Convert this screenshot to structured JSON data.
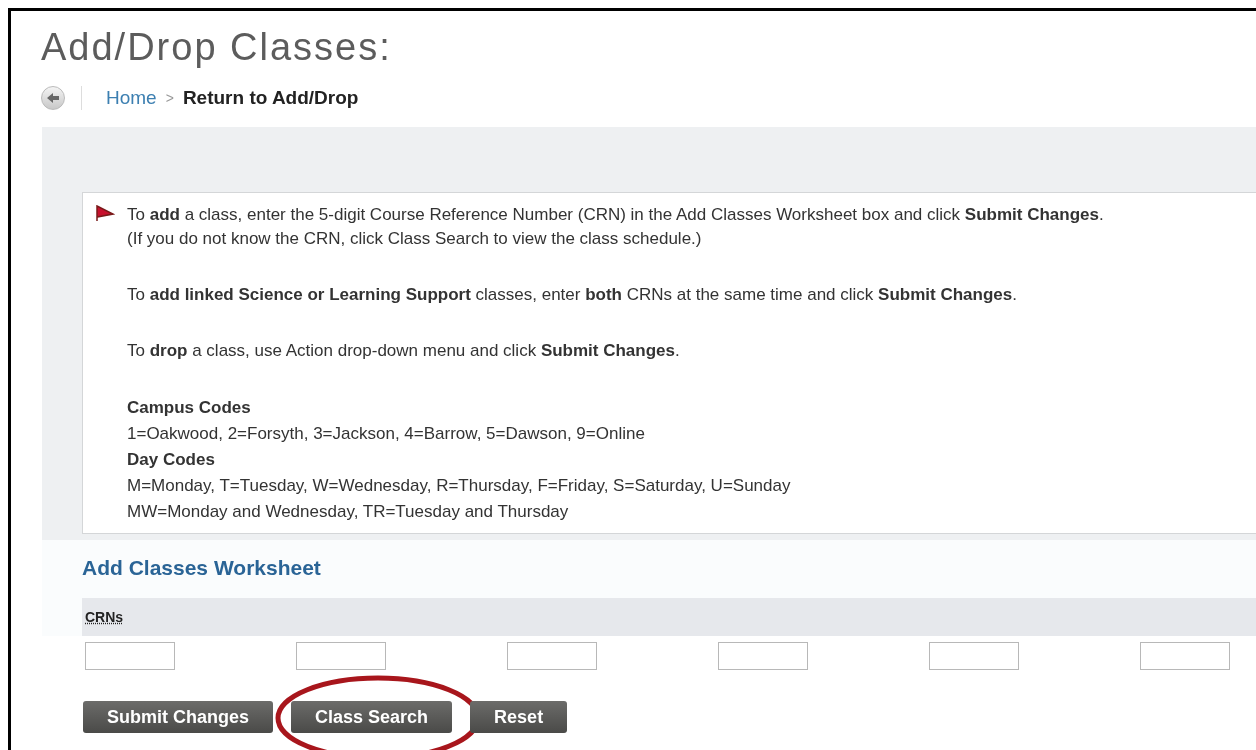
{
  "title": "Add/Drop Classes:",
  "breadcrumb": {
    "home": "Home",
    "separator": ">",
    "current": "Return to Add/Drop"
  },
  "instructions": [
    {
      "kind": "paragraph",
      "flag": true,
      "lines": [
        "To **add** a class, enter the 5-digit Course Reference Number (CRN) in the Add Classes Worksheet box and click **Submit Changes**.",
        "(If you do not know the CRN, click Class Search to view the class schedule.)"
      ]
    },
    {
      "kind": "paragraph",
      "flag": false,
      "lines": [
        "To **add linked Science or Learning Support** classes, enter **both** CRNs at the same time and click **Submit Changes**."
      ]
    },
    {
      "kind": "paragraph",
      "flag": false,
      "lines": [
        "To **drop** a class, use Action drop-down menu and click **Submit Changes**."
      ]
    },
    {
      "kind": "heading",
      "text": "Campus Codes"
    },
    {
      "kind": "line",
      "text": "1=Oakwood, 2=Forsyth, 3=Jackson, 4=Barrow, 5=Dawson, 9=Online"
    },
    {
      "kind": "heading",
      "text": "Day Codes"
    },
    {
      "kind": "line",
      "text": "M=Monday, T=Tuesday, W=Wednesday, R=Thursday, F=Friday, S=Saturday, U=Sunday"
    },
    {
      "kind": "line",
      "text": "MW=Monday and Wednesday, TR=Tuesday and Thursday"
    }
  ],
  "worksheet": {
    "title": "Add Classes Worksheet",
    "column_header": "CRNs",
    "crn_fields": [
      {
        "kind": "input"
      },
      {
        "kind": "input"
      },
      {
        "kind": "input"
      },
      {
        "kind": "input"
      },
      {
        "kind": "input"
      },
      {
        "kind": "input"
      }
    ]
  },
  "buttons": [
    {
      "label": "Submit Changes",
      "highlighted": false
    },
    {
      "label": "Class Search",
      "highlighted": true
    },
    {
      "label": "Reset",
      "highlighted": false
    }
  ]
}
